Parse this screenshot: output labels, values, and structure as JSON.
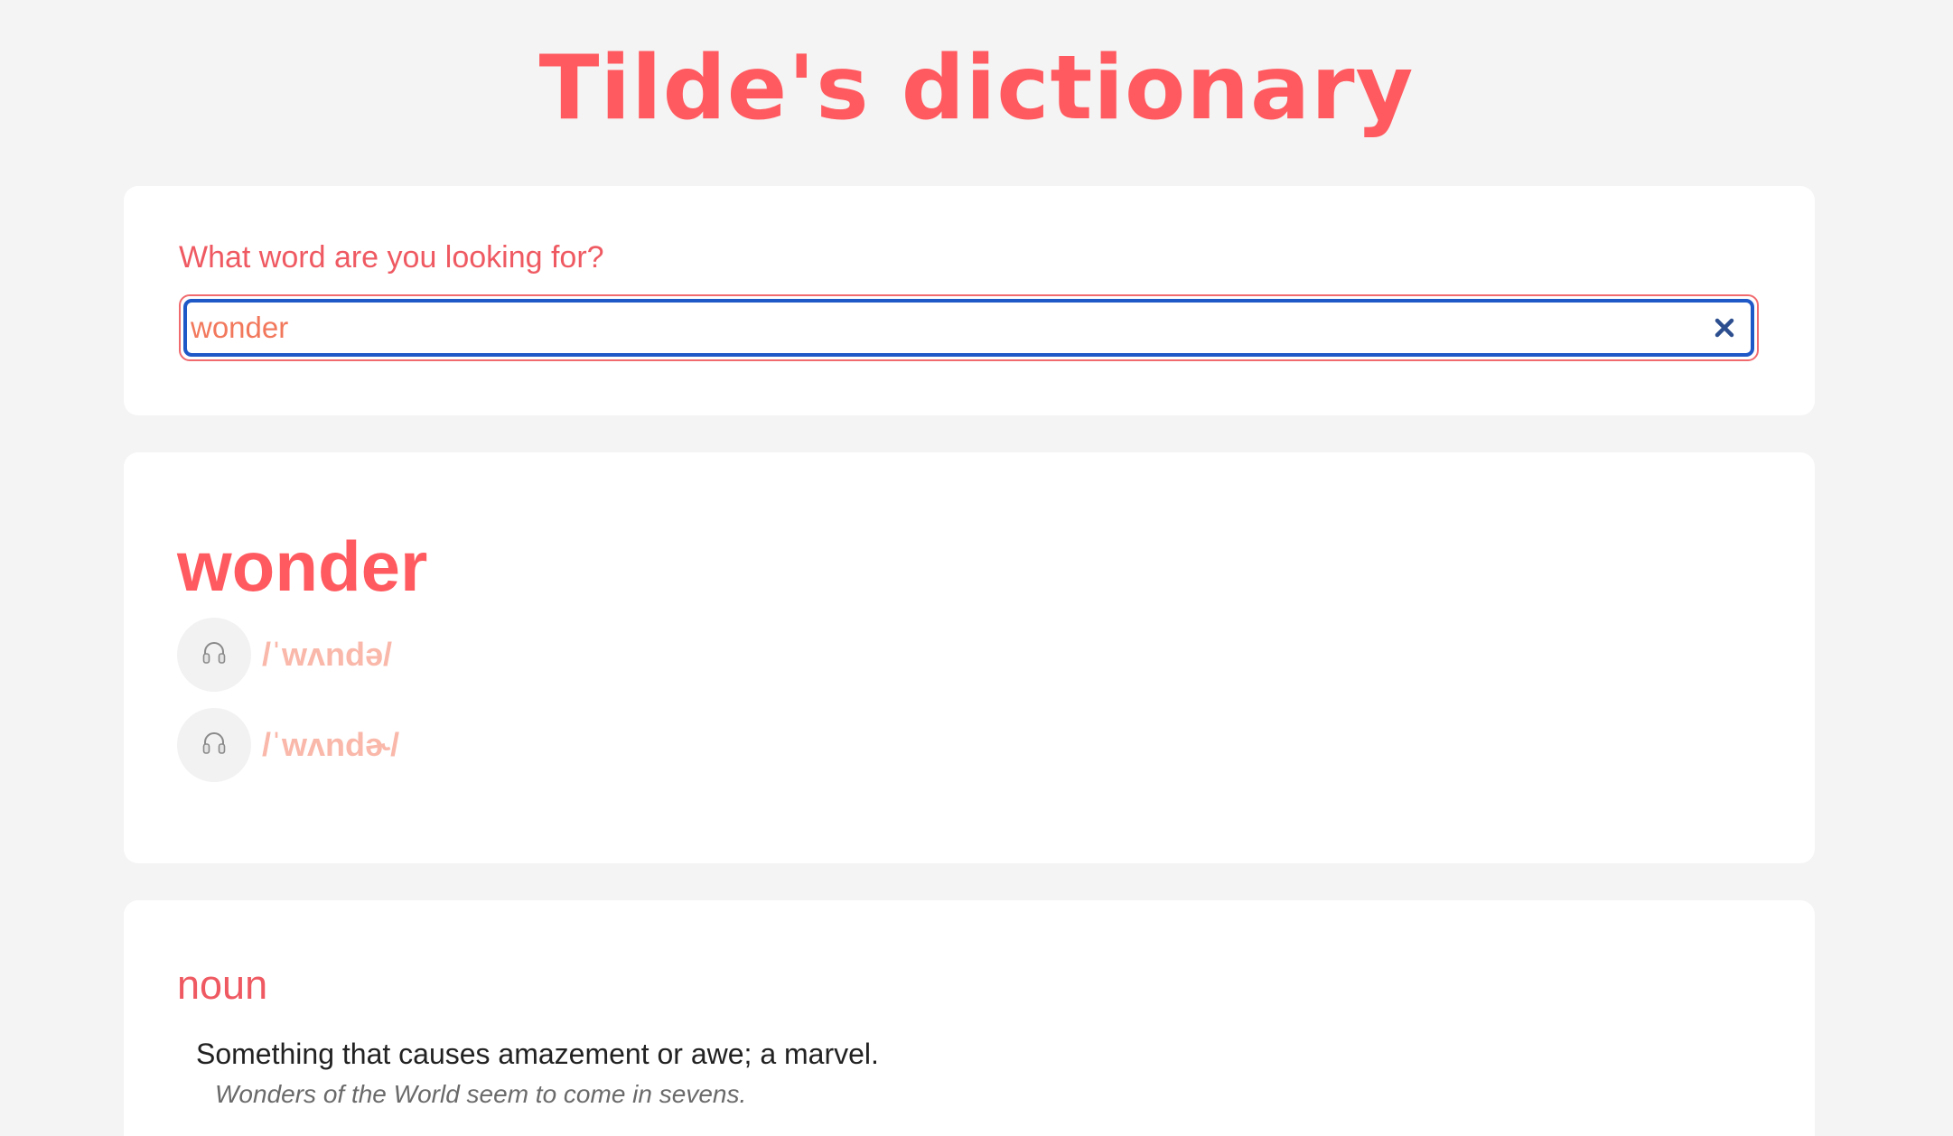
{
  "app": {
    "title": "Tilde's dictionary"
  },
  "search": {
    "label": "What word are you looking for?",
    "value": "wonder",
    "clear_icon": "close-icon"
  },
  "result": {
    "word": "wonder",
    "phonetics": [
      {
        "text": "/ˈwʌndə/",
        "icon": "headphones-icon"
      },
      {
        "text": "/ˈwʌndɚ/",
        "icon": "headphones-icon"
      }
    ]
  },
  "meanings": [
    {
      "part_of_speech": "noun",
      "definition": "Something that causes amazement or awe; a marvel.",
      "example": "Wonders of the World seem to come in sevens."
    }
  ],
  "colors": {
    "accent": "#ff5a5f",
    "phonetic": "#f9b8aa",
    "focus_ring": "#1f58c7",
    "background": "#f4f4f4"
  }
}
